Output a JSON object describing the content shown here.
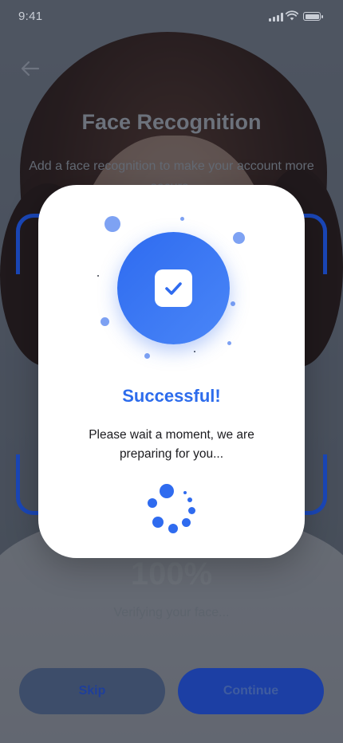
{
  "status_bar": {
    "time": "9:41"
  },
  "header": {
    "title": "Face Recognition",
    "subtitle": "Add a face recognition to make your account more secure."
  },
  "scan": {
    "progress_percent": "100%",
    "status_text": "Verifying your face..."
  },
  "actions": {
    "skip_label": "Skip",
    "continue_label": "Continue"
  },
  "dialog": {
    "title": "Successful!",
    "message": "Please wait a moment, we are preparing for you..."
  },
  "colors": {
    "primary": "#2f6bef",
    "dark_blue": "#1a47b8",
    "overlay": "#101624"
  },
  "icons": [
    "back-arrow-icon",
    "check-icon",
    "loading-spinner-icon",
    "signal-icon",
    "wifi-icon",
    "battery-icon"
  ]
}
